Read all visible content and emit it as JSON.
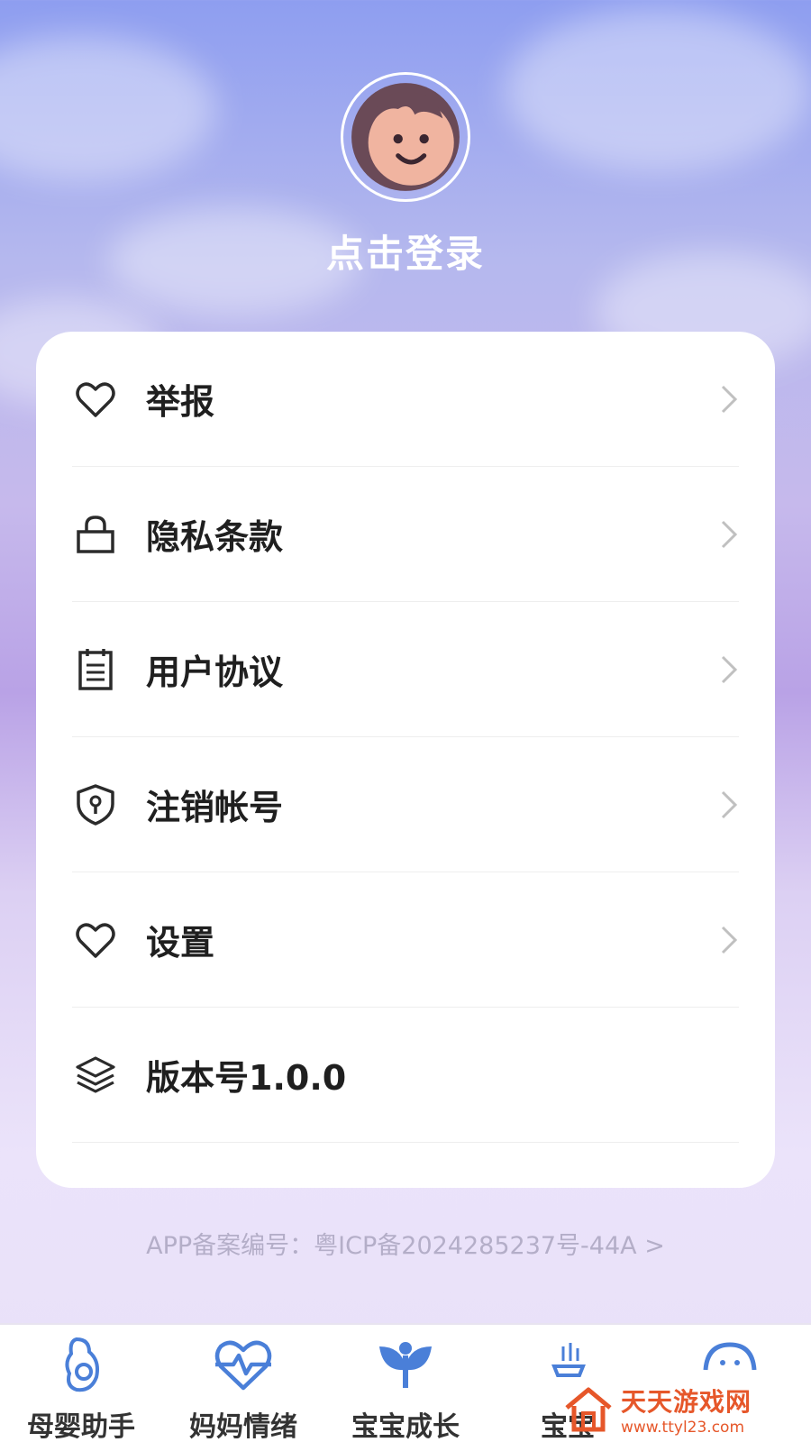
{
  "header": {
    "login_text": "点击登录"
  },
  "menu": [
    {
      "label": "举报",
      "icon": "heart-icon",
      "chevron": true
    },
    {
      "label": "隐私条款",
      "icon": "lock-icon",
      "chevron": true
    },
    {
      "label": "用户协议",
      "icon": "clipboard-icon",
      "chevron": true
    },
    {
      "label": "注销帐号",
      "icon": "shield-key-icon",
      "chevron": true
    },
    {
      "label": "设置",
      "icon": "heart-icon",
      "chevron": true
    },
    {
      "label": "版本号1.0.0",
      "icon": "layers-icon",
      "chevron": false
    }
  ],
  "footer": {
    "icp": "APP备案编号：粤ICP备2024285237号-44A >"
  },
  "tabs": [
    {
      "label": "母婴助手",
      "icon": "pregnant-icon"
    },
    {
      "label": "妈妈情绪",
      "icon": "heartbeat-icon"
    },
    {
      "label": "宝宝成长",
      "icon": "sprout-icon"
    },
    {
      "label": "宝宝",
      "icon": "bottle-icon"
    },
    {
      "label": "",
      "icon": "baby-face-icon"
    }
  ],
  "watermark": {
    "name": "天天游戏网",
    "url": "www.ttyl23.com"
  },
  "colors": {
    "accent": "#4a7fd8",
    "text": "#1f1f1f",
    "muted": "#b4aec8",
    "watermark": "#e6572a"
  }
}
